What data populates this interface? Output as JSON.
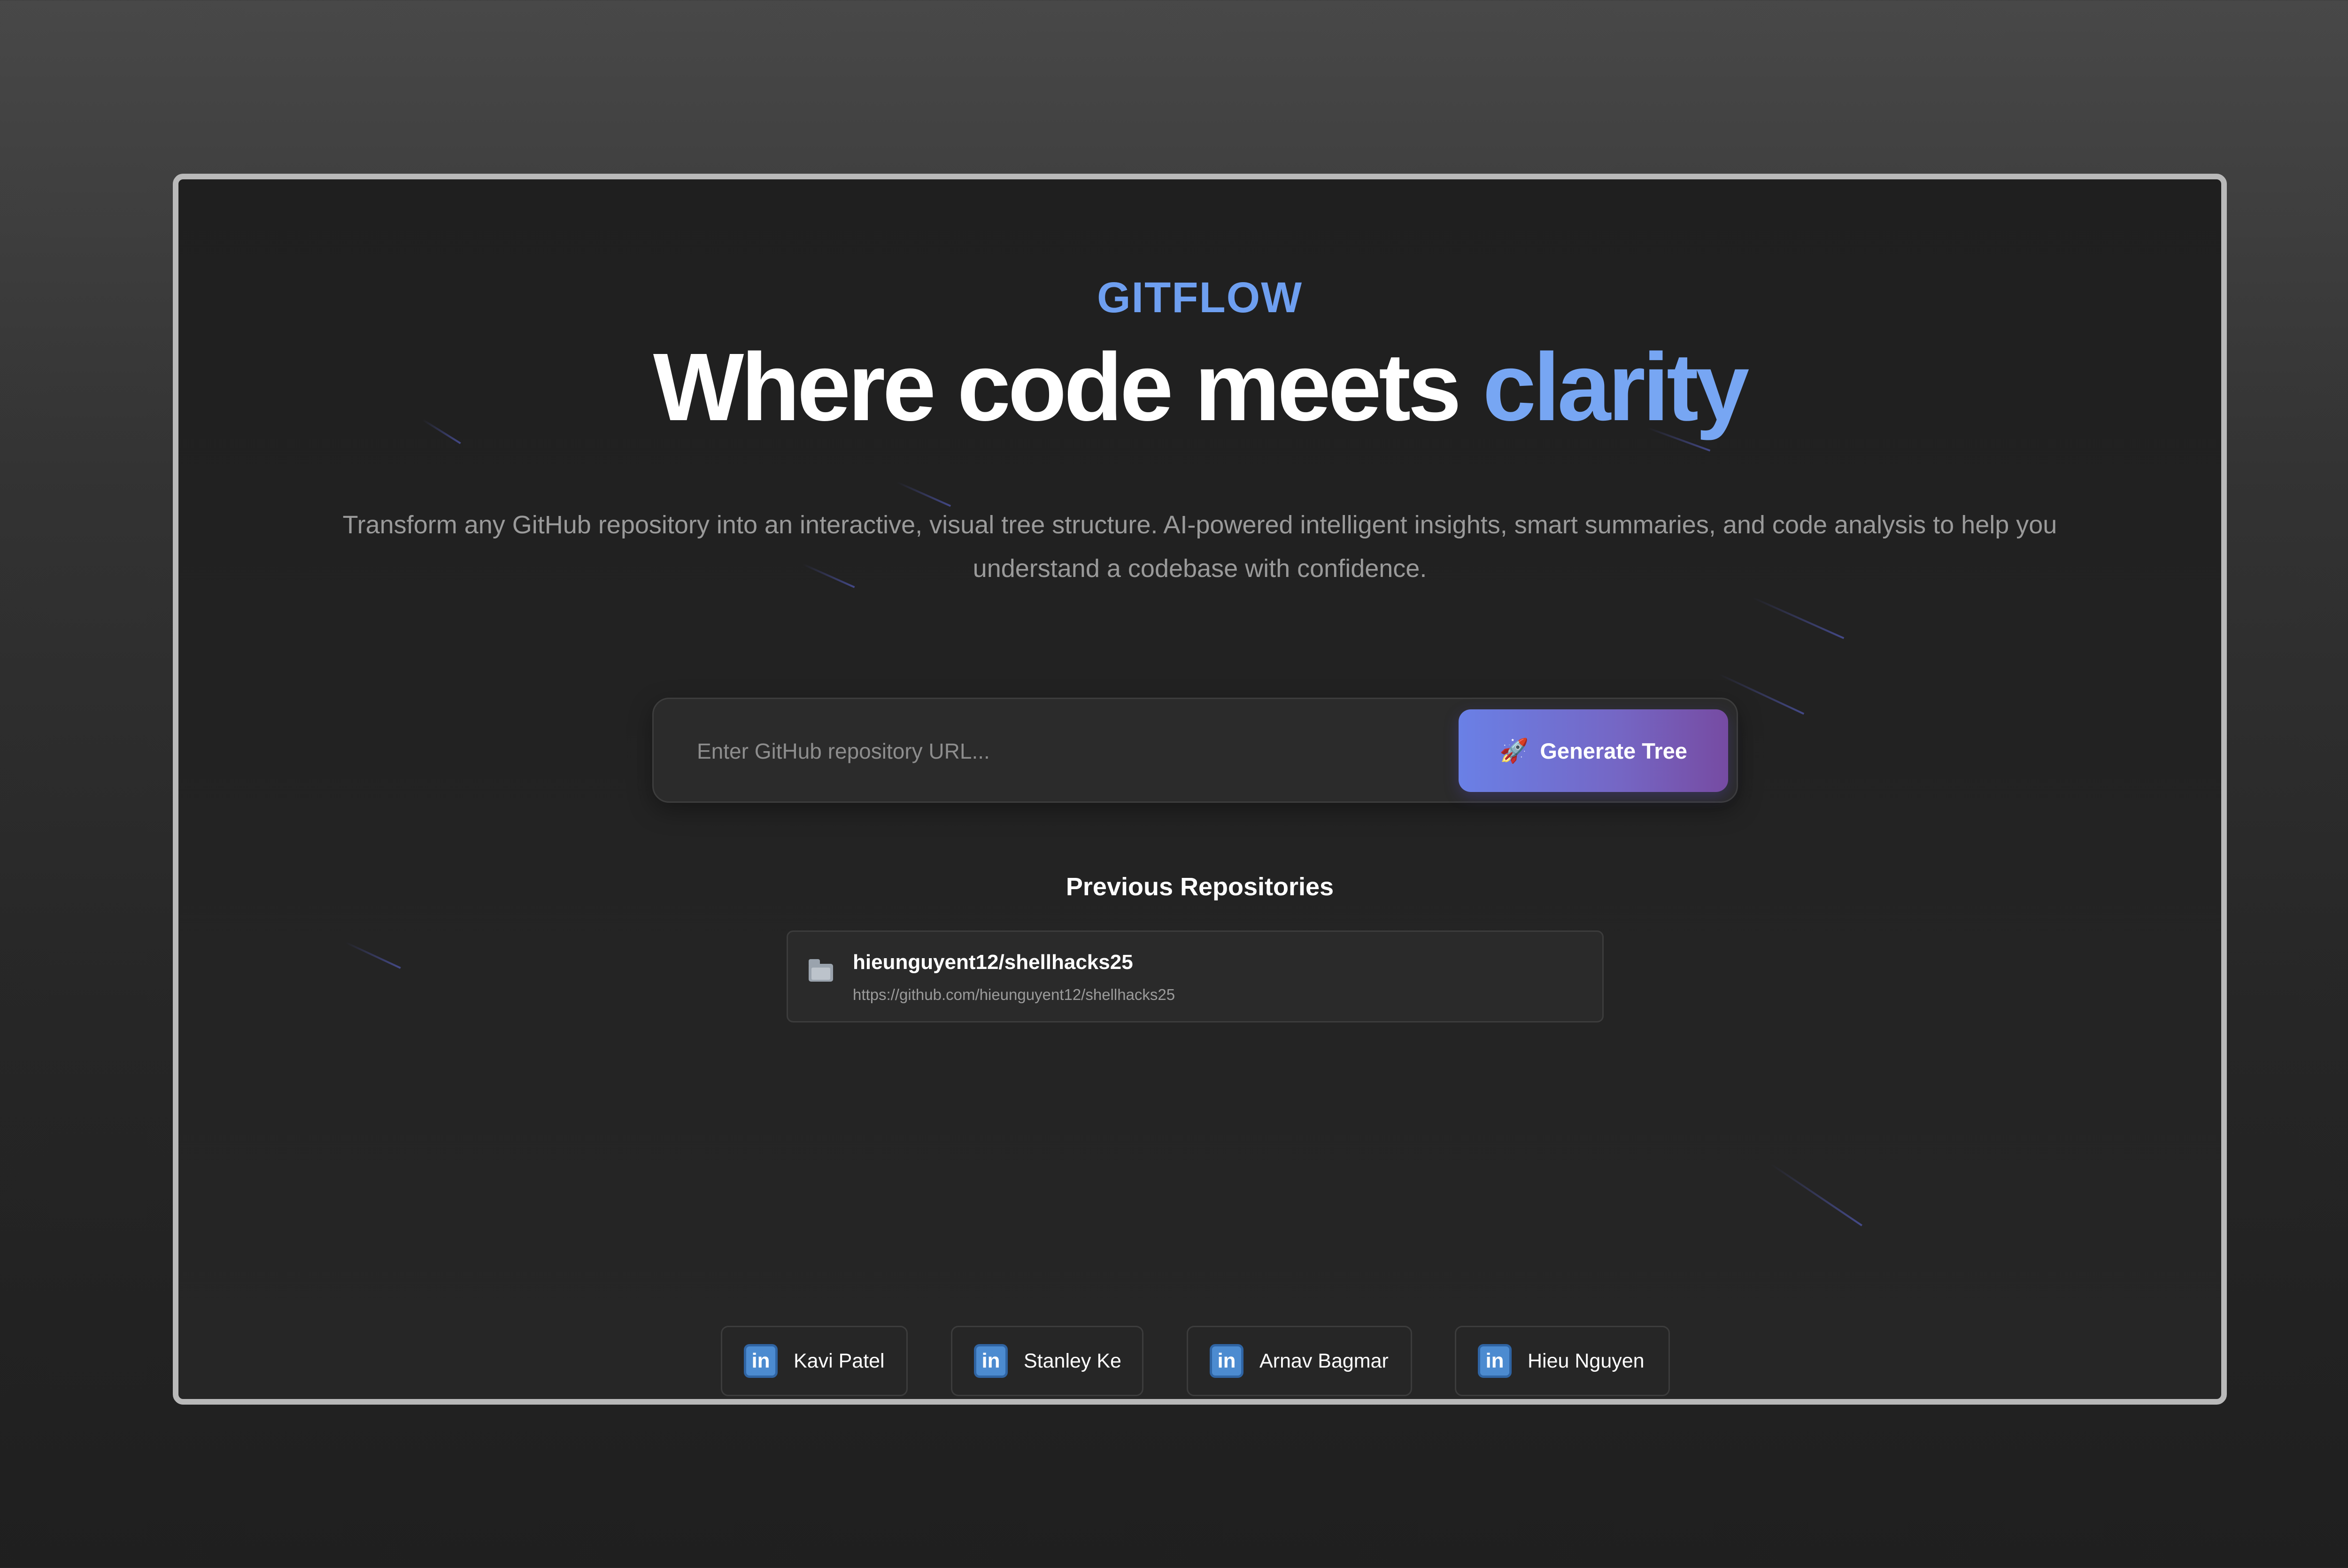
{
  "brand": {
    "name": "GITFLOW"
  },
  "hero": {
    "title_main": "Where code meets",
    "title_accent": "clarity"
  },
  "tagline": "Transform any GitHub repository into an interactive, visual tree structure. AI-powered intelligent insights, smart summaries, and code analysis to help you understand a codebase with confidence.",
  "search": {
    "placeholder": "Enter GitHub repository URL...",
    "value": "",
    "button_label": "Generate Tree",
    "button_icon": "rocket-icon"
  },
  "previous": {
    "title": "Previous Repositories",
    "items": [
      {
        "name": "hieunguyent12/shellhacks25",
        "url": "https://github.com/hieunguyent12/shellhacks25",
        "icon": "folder-icon"
      }
    ]
  },
  "creators": {
    "icon": "linkedin-icon",
    "icon_glyph": "in",
    "items": [
      {
        "name": "Kavi Patel"
      },
      {
        "name": "Stanley Ke"
      },
      {
        "name": "Arnav Bagmar"
      },
      {
        "name": "Hieu Nguyen"
      }
    ]
  },
  "colors": {
    "accent": "#77a6f3",
    "brand": "#6e9ff0",
    "button_start": "#6a80e6",
    "button_end": "#764ba2",
    "linkedin": "#4c8bd0"
  }
}
